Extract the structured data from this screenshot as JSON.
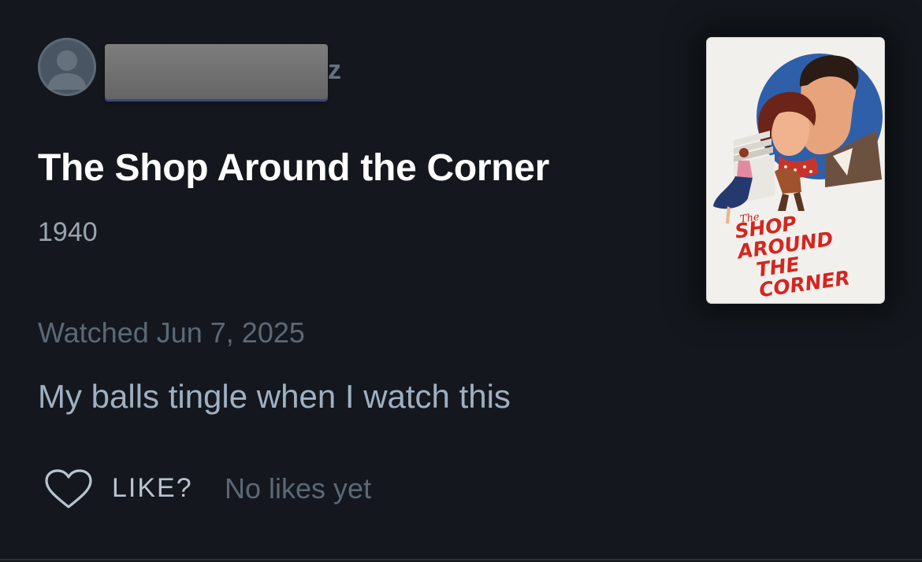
{
  "author": {
    "username_visible_suffix": "z",
    "avatar_icon": "default-user-icon"
  },
  "film": {
    "title": "The Shop Around the Corner",
    "year": "1940",
    "poster": {
      "top_word": "The",
      "line1": "SHOP AROUND",
      "line2": "THE CORNER"
    }
  },
  "review": {
    "watched": "Watched Jun 7, 2025",
    "text": "My balls tingle when I watch this"
  },
  "likes": {
    "button_label": "LIKE?",
    "count_text": "No likes yet",
    "icon": "heart-outline-icon"
  },
  "colors": {
    "background": "#14181e",
    "title": "#ffffff",
    "muted": "#5c6876",
    "review_text": "#9fb0c2",
    "poster_red": "#d4261f"
  }
}
